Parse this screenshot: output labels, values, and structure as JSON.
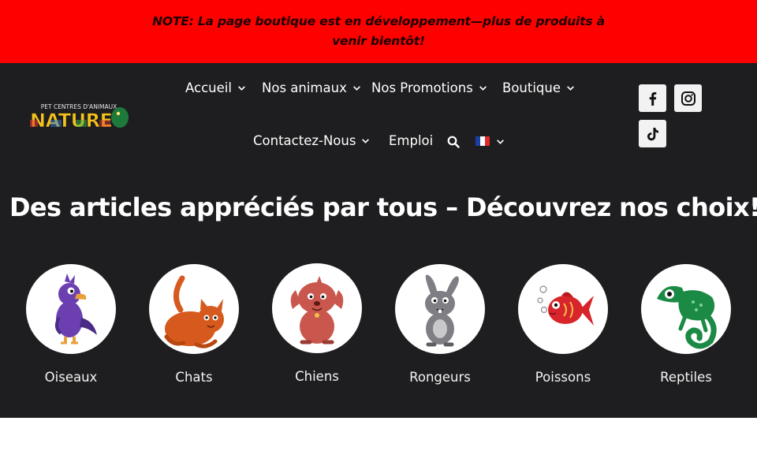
{
  "notice": {
    "text": "NOTE: La page boutique est en développement—plus de produits à venir bientôt!"
  },
  "logo": {
    "top_text": "PET CENTRES D'ANIMAUX",
    "main_text": "NATURE"
  },
  "nav": {
    "items": [
      {
        "label": "Accueil",
        "has_dropdown": true
      },
      {
        "label": "Nos animaux",
        "has_dropdown": true
      },
      {
        "label": "Nos Promotions",
        "has_dropdown": true
      },
      {
        "label": "Boutique",
        "has_dropdown": true
      },
      {
        "label": "Contactez-Nous",
        "has_dropdown": true
      },
      {
        "label": "Emploi",
        "has_dropdown": false
      }
    ],
    "search_icon": "search-icon",
    "language_icon": "french-flag-icon"
  },
  "social": {
    "icons": [
      "facebook-icon",
      "instagram-icon",
      "tiktok-icon"
    ]
  },
  "hero": {
    "headline": "Des articles appréciés par tous – Découvrez nos choix!"
  },
  "categories": [
    {
      "label": "Oiseaux",
      "icon": "bird-icon",
      "color": "#6b3fb0"
    },
    {
      "label": "Chats",
      "icon": "cat-icon",
      "color": "#d65a1e"
    },
    {
      "label": "Chiens",
      "icon": "dog-icon",
      "color": "#c9574d"
    },
    {
      "label": "Rongeurs",
      "icon": "rabbit-icon",
      "color": "#7e7e84"
    },
    {
      "label": "Poissons",
      "icon": "fish-icon",
      "color": "#d8242b"
    },
    {
      "label": "Reptiles",
      "icon": "chameleon-icon",
      "color": "#1a8a44"
    }
  ],
  "colors": {
    "notice_bg": "#ff0000",
    "header_bg": "#1e1e20",
    "text_light": "#ffffff"
  }
}
